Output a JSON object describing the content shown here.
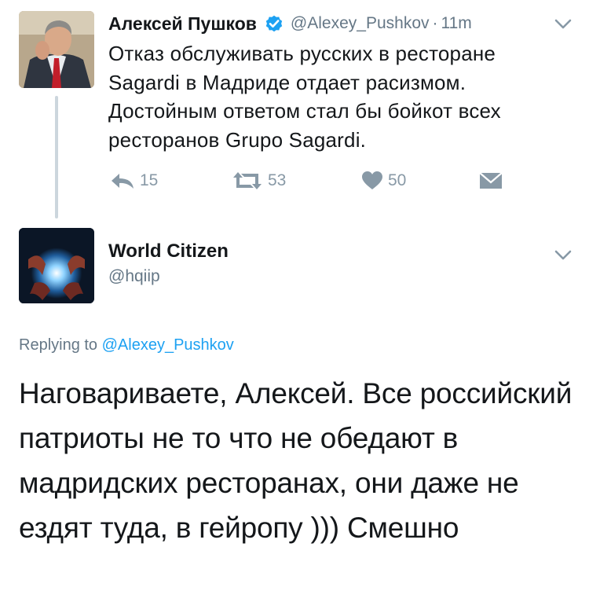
{
  "tweet1": {
    "author_name": "Алексей Пушков",
    "handle": "@Alexey_Pushkov",
    "separator": "·",
    "time": "11m",
    "text": "Отказ обслуживать русских в ресторане Sagardi в Мадриде отдает расизмом. Достойным ответом стал бы бойкот всех ресторанов Grupo Sagardi.",
    "verified": true,
    "actions": {
      "reply_icon": "reply-arrow-icon",
      "reply_count": "15",
      "retweet_icon": "retweet-icon",
      "retweet_count": "53",
      "like_icon": "heart-icon",
      "like_count": "50",
      "dm_icon": "envelope-icon"
    }
  },
  "tweet2": {
    "author_name": "World Citizen",
    "handle": "@hqiip",
    "replying_prefix": "Replying to",
    "replying_handle": "@Alexey_Pushkov",
    "text": "Наговариваете, Алексей. Все российский патриоты не то что не обедают в мадридских ресторанах, они даже не ездят туда, в гейропу ))) Смешно"
  },
  "colors": {
    "accent": "#1da1f2",
    "secondary_text": "#657786",
    "action_gray": "#8899a6",
    "thread_line": "#ccd6dd"
  }
}
